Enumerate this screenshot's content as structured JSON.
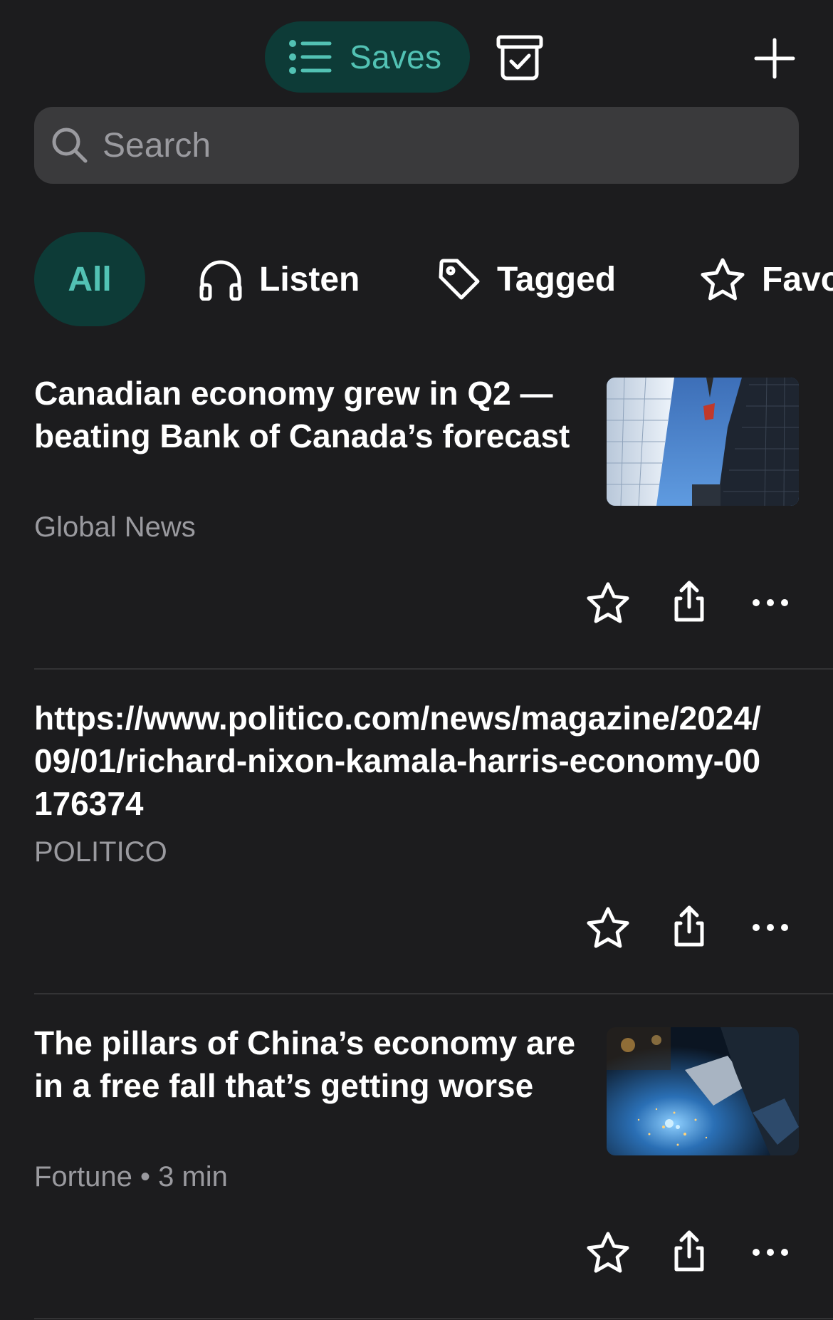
{
  "header": {
    "saves_label": "Saves",
    "icons": [
      "list-icon",
      "archive-check-icon",
      "plus-icon"
    ]
  },
  "search": {
    "placeholder": "Search"
  },
  "filters": [
    {
      "label": "All",
      "active": true
    },
    {
      "label": "Listen",
      "icon": "headphones-icon"
    },
    {
      "label": "Tagged",
      "icon": "tag-icon"
    },
    {
      "label": "Favo",
      "icon": "star-icon"
    }
  ],
  "items": [
    {
      "title": "Canadian economy grew in Q2 — beating Bank of Canada’s forecast",
      "source": "Global News",
      "thumbnail": "skyscrapers-image"
    },
    {
      "title": "https://www.politico.com/news/magazine/2024/09/01/richard-nixon-kamala-harris-economy-00176374",
      "source": "POLITICO"
    },
    {
      "title": "The pillars of China’s economy are in a free fall that’s getting worse",
      "source": "Fortune • 3 min",
      "thumbnail": "welding-sparks-image"
    }
  ],
  "colors": {
    "background": "#1c1c1e",
    "accent": "#52c2b4",
    "accent_bg": "#0d3b37",
    "search_bg": "#3a3a3c",
    "secondary_text": "#9a9a9f"
  }
}
